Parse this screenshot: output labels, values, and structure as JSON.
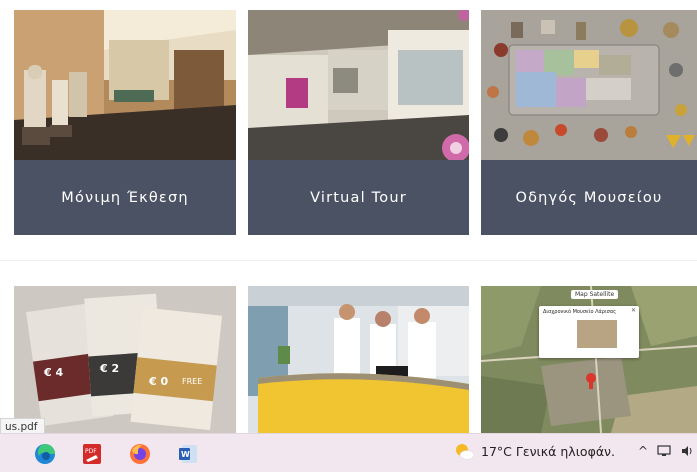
{
  "cards_top": [
    {
      "label": "Μόνιμη Έκθεση"
    },
    {
      "label": "Virtual Tour"
    },
    {
      "label": "Οδηγός Μουσείου"
    }
  ],
  "cards_bottom": [
    {
      "name": "tickets"
    },
    {
      "name": "reception-desk"
    },
    {
      "name": "location-map",
      "popup_title": "Διαχρονικό Μουσείο Λάρισας",
      "map_toggle": "Map  Satellite"
    }
  ],
  "ticket_prices": [
    "€ 4",
    "€ 2",
    "€ 0"
  ],
  "ticket_free_label": "FREE",
  "download_tooltip": "us.pdf",
  "taskbar": {
    "apps": [
      "edge",
      "pdf-reader",
      "firefox",
      "word"
    ],
    "weather": "17°C  Γενικά ηλιοφάν.",
    "tray_chevron": "^"
  }
}
